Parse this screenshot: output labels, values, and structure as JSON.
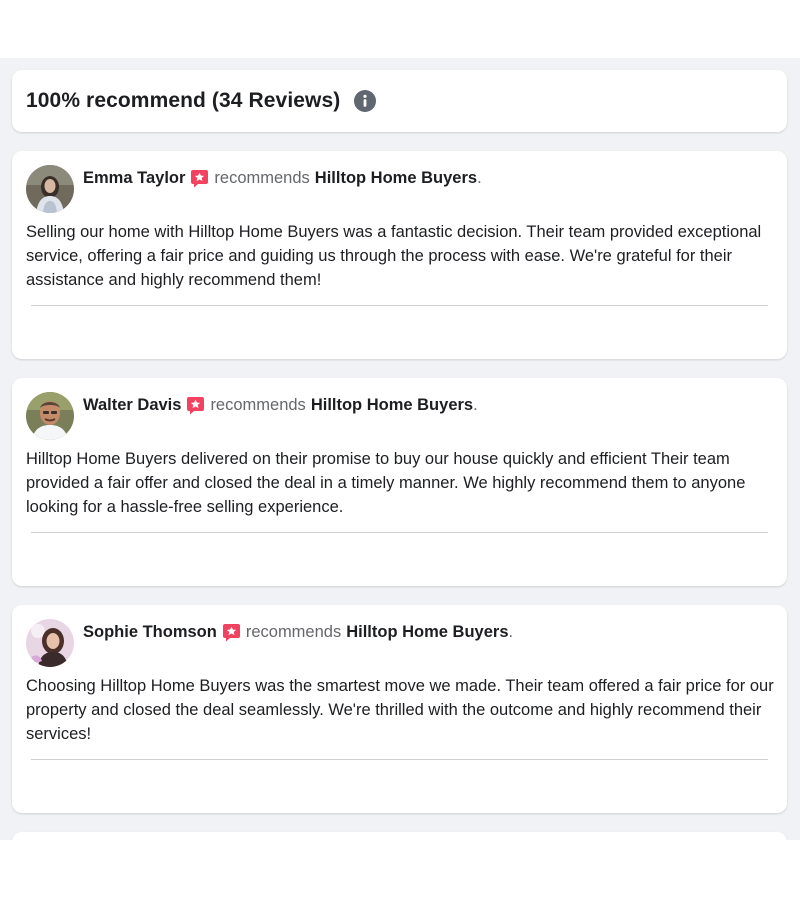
{
  "summary": {
    "title": "100% recommend (34 Reviews)",
    "info_icon": "info-icon"
  },
  "recommend_word": "recommends",
  "business_name": "Hilltop Home Buyers",
  "reviews": [
    {
      "reviewer": "Emma Taylor",
      "recommends": "recommends",
      "business": "Hilltop Home Buyers",
      "text": "Selling our home with Hilltop Home Buyers was a fantastic decision. Their team provided exceptional service, offering a fair price and guiding us through the process with ease. We're grateful for their assistance and highly recommend them!"
    },
    {
      "reviewer": "Walter Davis",
      "recommends": "recommends",
      "business": "Hilltop Home Buyers",
      "text": "Hilltop Home Buyers delivered on their promise to buy our house quickly and efficient Their team provided a fair offer and closed the deal in a timely manner. We highly recommend them to anyone looking for a hassle-free selling experience."
    },
    {
      "reviewer": "Sophie Thomson",
      "recommends": "recommends",
      "business": "Hilltop Home Buyers",
      "text": "Choosing Hilltop Home Buyers was the smartest move we made. Their team offered a fair price for our property and closed the deal seamlessly. We're thrilled with the outcome and highly recommend their services!"
    }
  ],
  "colors": {
    "feed_background": "#f0f2f5",
    "card_background": "#ffffff",
    "recommend_badge": "#f3425f",
    "secondary_text": "#65676b",
    "divider": "#ced0d4"
  }
}
